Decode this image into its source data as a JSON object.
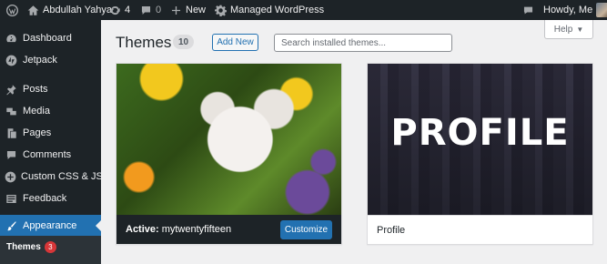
{
  "admin_bar": {
    "site_name": "Abdullah Yahya",
    "updates_count": "4",
    "comments_count": "0",
    "new_label": "New",
    "managed_label": "Managed WordPress",
    "greeting": "Howdy, Me"
  },
  "sidebar": {
    "items": [
      {
        "label": "Dashboard",
        "icon": "dashboard-icon"
      },
      {
        "label": "Jetpack",
        "icon": "jetpack-icon"
      },
      {
        "label": "Posts",
        "icon": "pin-icon"
      },
      {
        "label": "Media",
        "icon": "media-icon"
      },
      {
        "label": "Pages",
        "icon": "pages-icon"
      },
      {
        "label": "Comments",
        "icon": "comment-icon"
      },
      {
        "label": "Custom CSS & JS",
        "icon": "plus-circle-icon"
      },
      {
        "label": "Feedback",
        "icon": "feedback-icon"
      },
      {
        "label": "Appearance",
        "icon": "brush-icon"
      }
    ],
    "submenu": {
      "label": "Themes",
      "badge": "3"
    }
  },
  "header": {
    "title": "Themes",
    "count": "10",
    "add_new": "Add New",
    "search_placeholder": "Search installed themes...",
    "help": "Help"
  },
  "themes": {
    "active": {
      "prefix": "Active:",
      "name": "mytwentyfifteen",
      "customize": "Customize"
    },
    "profile": {
      "name": "Profile",
      "logo_text": "PROFILE"
    }
  },
  "colors": {
    "accent": "#2271b1",
    "admin_bg": "#1d2327",
    "badge": "#d63638"
  }
}
